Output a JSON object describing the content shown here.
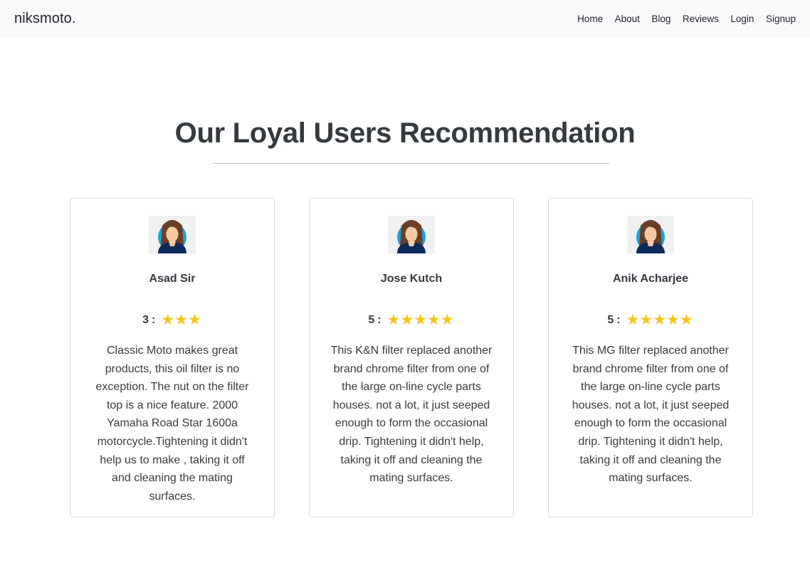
{
  "navbar": {
    "brand": "niksmoto.",
    "links": [
      "Home",
      "About",
      "Blog",
      "Reviews",
      "Login",
      "Signup"
    ]
  },
  "section": {
    "title": "Our Loyal Users Recommendation"
  },
  "reviews": [
    {
      "name": "Asad Sir",
      "rating": "3",
      "separator": ":",
      "stars": "★★★",
      "text": "Classic Moto makes great products, this oil filter is no exception. The nut on the filter top is a nice feature. 2000 Yamaha Road Star 1600a motorcycle.Tightening it didn't help us to make , taking it off and cleaning the mating surfaces."
    },
    {
      "name": "Jose Kutch",
      "rating": "5",
      "separator": ":",
      "stars": "★★★★★",
      "text": "This K&N filter replaced another brand chrome filter from one of the large on-line cycle parts houses. not a lot, it just seeped enough to form the occasional drip. Tightening it didn't help, taking it off and cleaning the mating surfaces."
    },
    {
      "name": "Anik Acharjee",
      "rating": "5",
      "separator": ":",
      "stars": "★★★★★",
      "text": "This MG filter replaced another brand chrome filter from one of the large on-line cycle parts houses. not a lot, it just seeped enough to form the occasional drip. Tightening it didn't help, taking it off and cleaning the mating surfaces."
    }
  ],
  "colors": {
    "star": "#f5c518",
    "navbar_bg": "#f8f9fa",
    "heading": "#343a40",
    "avatar_ring": "#1aa3d6",
    "avatar_shirt": "#0d2a5c",
    "avatar_hair": "#6b3e26",
    "avatar_skin": "#f4c9a0"
  },
  "icons": {
    "avatar": "woman-avatar-icon",
    "star": "star-icon"
  }
}
